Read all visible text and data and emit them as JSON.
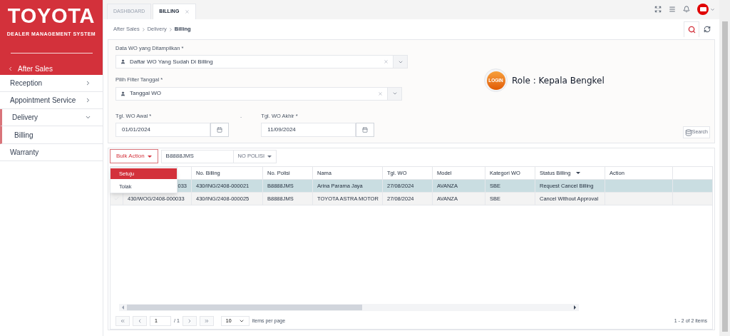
{
  "brand": {
    "logo": "TOYOTA",
    "subtitle": "DEALER MANAGEMENT SYSTEM",
    "section": "After Sales"
  },
  "sidebar": {
    "items": [
      {
        "label": "Reception",
        "expanded": false,
        "selected": false
      },
      {
        "label": "Appointment Service",
        "expanded": false,
        "selected": false
      },
      {
        "label": "Delivery",
        "expanded": true,
        "selected": true,
        "children": [
          {
            "label": "Billing"
          }
        ]
      },
      {
        "label": "Warranty",
        "selected": false
      }
    ]
  },
  "tabs": [
    {
      "label": "DASHBOARD",
      "selected": false,
      "closable": false
    },
    {
      "label": "BILLING",
      "selected": true,
      "closable": true
    }
  ],
  "breadcrumb": [
    "After Sales",
    "Delivery",
    "Billing"
  ],
  "filters": {
    "data_wo": {
      "label": "Data WO yang Ditampilkan *",
      "value": "Daftar WO Yang Sudah Di Billing"
    },
    "date_filter": {
      "label": "Pilih Filter Tanggal *",
      "value": "Tanggal WO"
    },
    "start": {
      "label": "Tgl. WO Awal *",
      "value": "01/01/2024"
    },
    "separator": "-",
    "end": {
      "label": "Tgl. WO Akhir *",
      "value": "11/09/2024"
    },
    "search_button": "Search"
  },
  "login_badge": {
    "icon_text": "LOGIN",
    "role": "Role : Kepala Bengkel"
  },
  "toolbar": {
    "bulk_action": "Bulk Action",
    "search_value": "B8888JMS",
    "search_field": "NO POLISI"
  },
  "bulk_menu": [
    {
      "label": "Setuju",
      "selected": true
    },
    {
      "label": "Tolak",
      "selected": false
    }
  ],
  "table": {
    "columns": [
      "",
      "No. Billing",
      "No. Polisi",
      "Nama",
      "Tgl. WO",
      "Model",
      "Kategori WO",
      "Status Billing",
      "Action"
    ],
    "rows": [
      {
        "selected": true,
        "cells": [
          "033",
          "430/ING/2408-000021",
          "B8888JMS",
          "Arina Parama Jaya",
          "27/08/2024",
          "AVANZA",
          "SBE",
          "Request Cancel Billing",
          ""
        ]
      },
      {
        "selected": false,
        "cells": [
          "430/WOG/2408-000033",
          "430/ING/2408-000025",
          "B8888JMS",
          "TOYOTA ASTRA MOTOR",
          "27/08/2024",
          "AVANZA",
          "SBE",
          "Cancel Without Approval",
          ""
        ]
      }
    ]
  },
  "pager": {
    "page": "1",
    "of": "/ 1",
    "page_size": "10",
    "per_page_label": "items per page",
    "summary": "1 - 2 of 2 items"
  }
}
